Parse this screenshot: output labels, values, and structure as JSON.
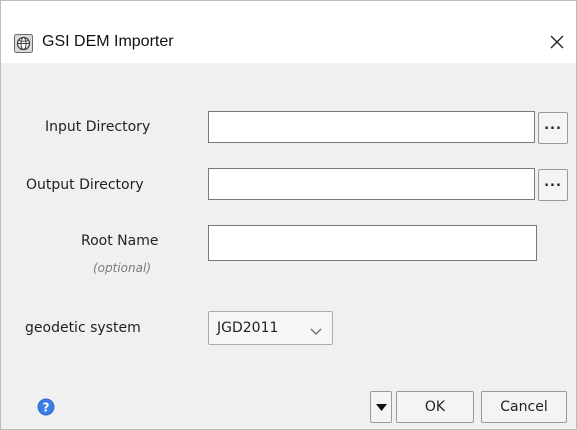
{
  "window": {
    "title": "GSI DEM Importer",
    "icon": "globe-icon",
    "close_icon": "close-icon"
  },
  "form": {
    "input_directory": {
      "label": "Input Directory",
      "value": "",
      "browse_label": "..."
    },
    "output_directory": {
      "label": "Output Directory",
      "value": "",
      "browse_label": "..."
    },
    "root_name": {
      "label": "Root Name",
      "hint": "(optional)",
      "value": ""
    },
    "geodetic_system": {
      "label": "geodetic system",
      "selected": "JGD2011"
    }
  },
  "footer": {
    "help_icon": "help-icon",
    "menu_icon": "triangle-down-icon",
    "ok_label": "OK",
    "cancel_label": "Cancel"
  },
  "colors": {
    "accent_help": "#2f6fd6",
    "window_bg": "#f0f0f0",
    "titlebar_bg": "#ffffff"
  }
}
